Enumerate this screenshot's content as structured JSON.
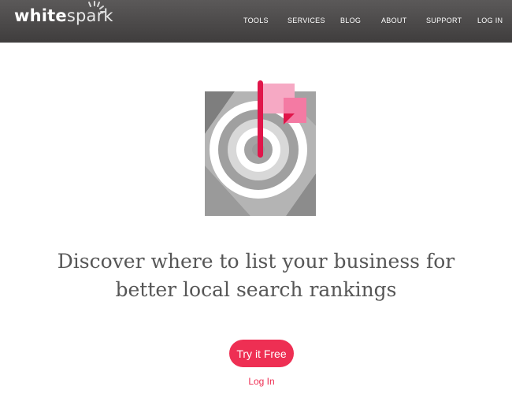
{
  "brand": {
    "logo_bold": "white",
    "logo_light": "spark",
    "logo_icon": "spark-burst-icon"
  },
  "nav": {
    "items": [
      {
        "label": "TOOLS"
      },
      {
        "label": "SERVICES"
      },
      {
        "label": "BLOG"
      },
      {
        "label": "ABOUT"
      },
      {
        "label": "SUPPORT"
      },
      {
        "label": "LOG IN"
      }
    ]
  },
  "hero": {
    "illustration": "target-with-flag-icon",
    "headline_line1": "Discover where to list your business for",
    "headline_line2": "better local search rankings",
    "cta_label": "Try it Free",
    "login_label": "Log In"
  },
  "colors": {
    "navbar": "#4a4848",
    "accent": "#ee2f53",
    "flag_light": "#f6a9c4",
    "headline_text": "#565656"
  }
}
